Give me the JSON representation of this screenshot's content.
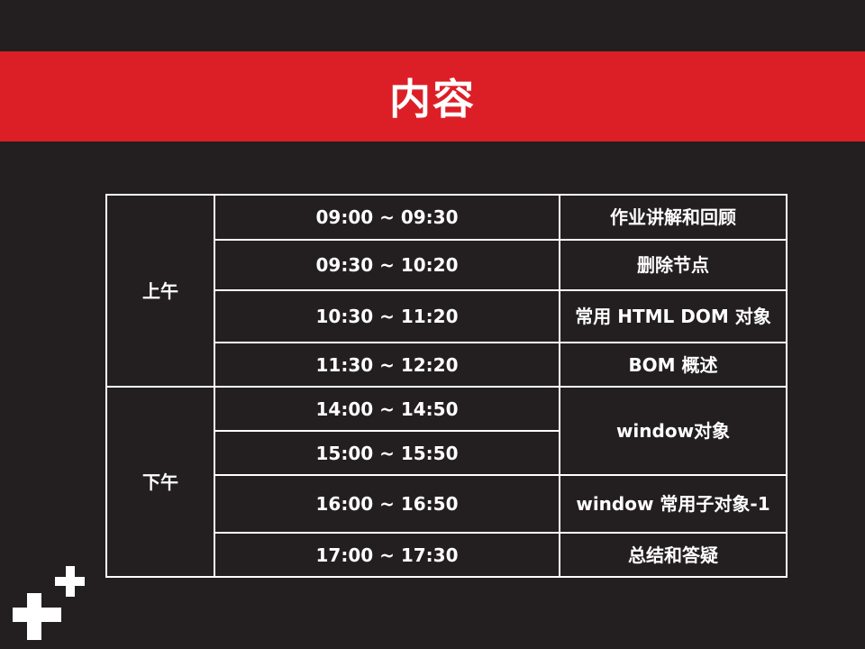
{
  "slide": {
    "title": "内容"
  },
  "schedule": {
    "morning_label": "上午",
    "afternoon_label": "下午",
    "rows": [
      {
        "time": "09:00 ~ 09:30",
        "topic": "作业讲解和回顾"
      },
      {
        "time": "09:30 ~ 10:20",
        "topic": "删除节点"
      },
      {
        "time": "10:30 ~ 11:20",
        "topic": "常用 HTML DOM 对象"
      },
      {
        "time": "11:30 ~ 12:20",
        "topic": "BOM 概述"
      },
      {
        "time": "14:00 ~ 14:50",
        "topic": "window对象"
      },
      {
        "time": "15:00 ~ 15:50"
      },
      {
        "time": "16:00 ~ 16:50",
        "topic": "window 常用子对象-1"
      },
      {
        "time": "17:00 ~ 17:30",
        "topic": "总结和答疑"
      }
    ]
  },
  "colors": {
    "background": "#231f20",
    "banner": "#dc1f26",
    "text": "#ffffff"
  },
  "logo": {
    "icon": "plus-logo-icon"
  }
}
